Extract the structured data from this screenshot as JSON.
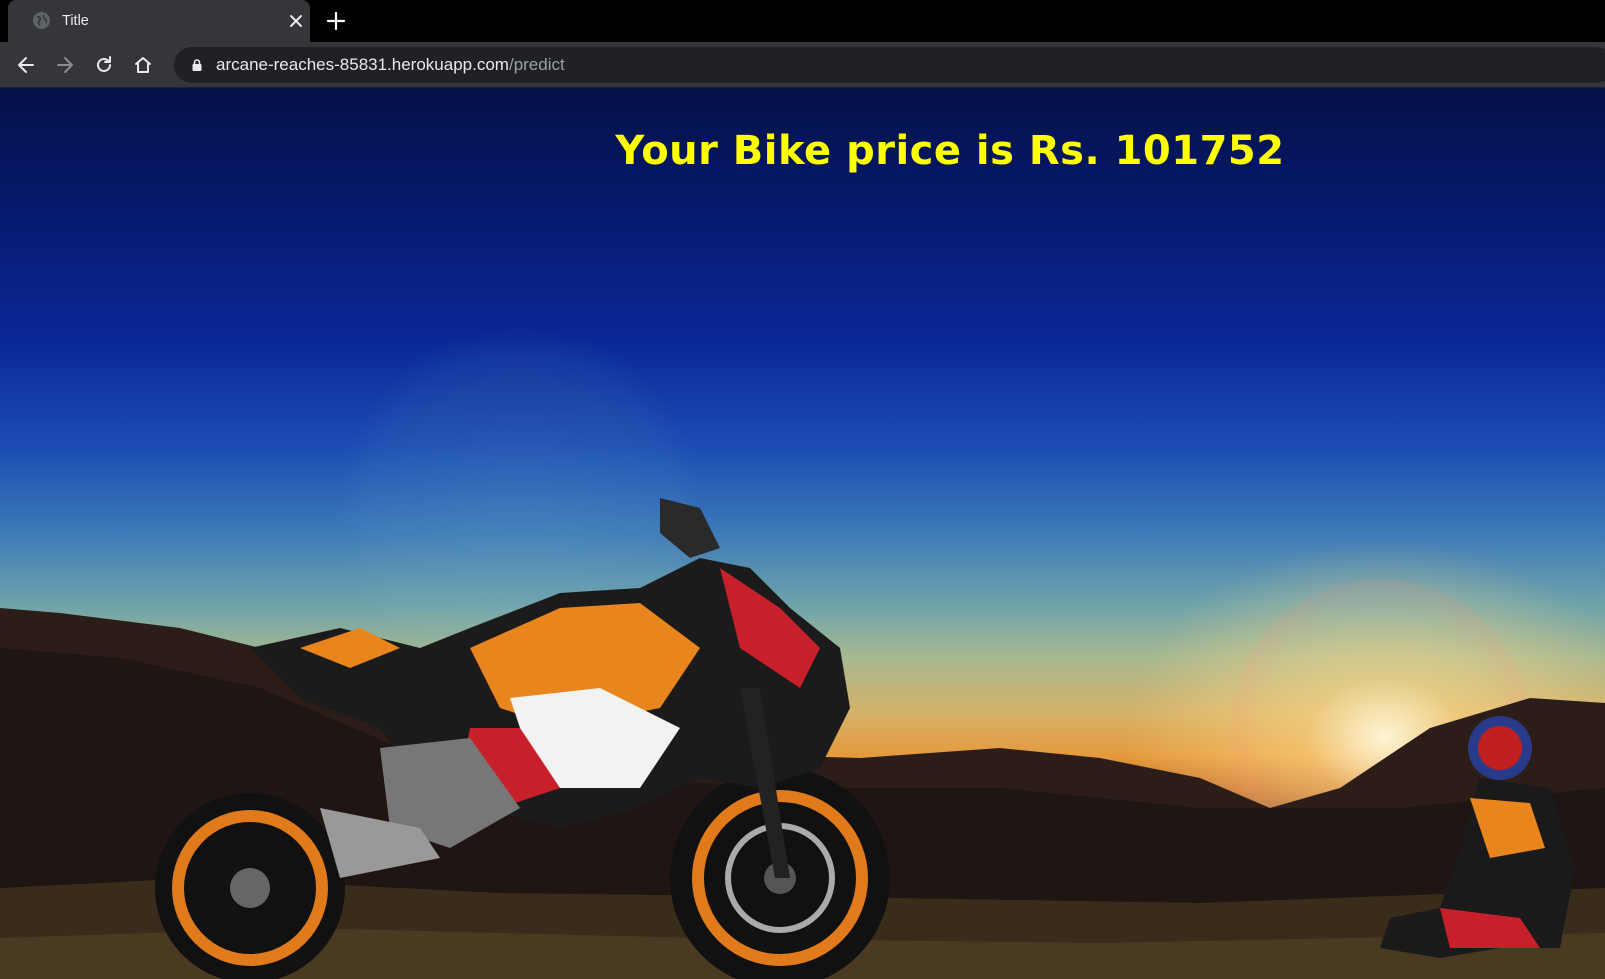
{
  "browser": {
    "tab": {
      "title": "Title",
      "favicon": "globe-icon",
      "close_icon": "close-icon"
    },
    "new_tab_icon": "plus-icon",
    "nav": {
      "back_icon": "arrow-left-icon",
      "forward_icon": "arrow-right-icon",
      "reload_icon": "reload-icon",
      "home_icon": "home-icon"
    },
    "address_bar": {
      "lock_icon": "lock-icon",
      "host": "arcane-reaches-85831.herokuapp.com",
      "path": "/predict"
    }
  },
  "page": {
    "heading": "Your Bike price is Rs. 101752",
    "heading_color": "#ffff00",
    "background_image": "motorcycle-sunset-photo"
  }
}
